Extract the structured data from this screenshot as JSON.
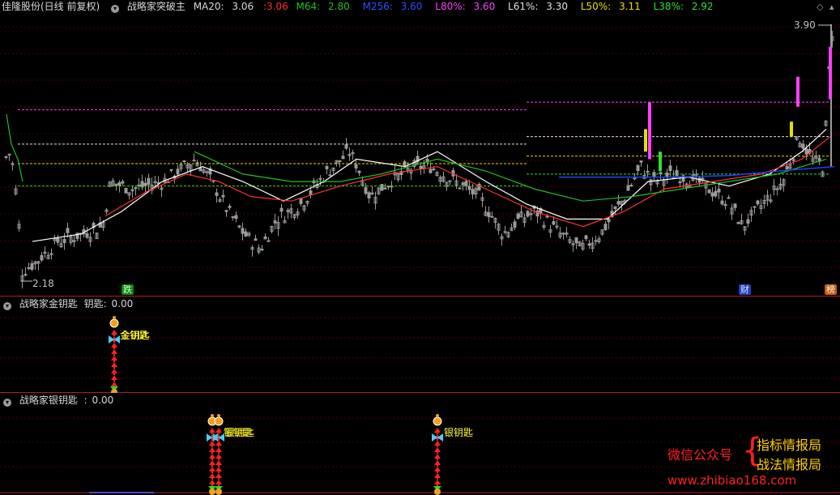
{
  "main_panel": {
    "title": "佳隆股份(日线 前复权)",
    "indicator_name": "战略家突破主",
    "ma20": {
      "label": "MA20:",
      "value": "3.06"
    },
    "extra_value": ":3.06",
    "m64": {
      "label": "M64:",
      "value": "2.80"
    },
    "m256": {
      "label": "M256:",
      "value": "3.60"
    },
    "l80": {
      "label": "L80%:",
      "value": "3.60"
    },
    "l61": {
      "label": "L61%:",
      "value": "3.30"
    },
    "l50": {
      "label": "L50%:",
      "value": "3.11"
    },
    "l38": {
      "label": "L38%:",
      "value": "2.92"
    },
    "high_label": "3.90",
    "low_label": "2.18",
    "markers": {
      "die": "跌",
      "cai": "财",
      "bang": "榜"
    }
  },
  "panel_gold": {
    "title": "战略家金钥匙",
    "series_label": "钥匙:",
    "series_value": "0.00",
    "signal_text": "金钥匙"
  },
  "panel_silver": {
    "title": "战略家银钥匙",
    "series_label": ":",
    "series_value": "0.00",
    "signal_text_a": "银钥匙",
    "signal_text_b": "银钥匙"
  },
  "watermark": {
    "wechat": "微信公众号",
    "line1": "指标情报局",
    "line2": "战法情报局",
    "url": "www.zhibiao168.com"
  },
  "colors": {
    "candle": "#9a9a9a",
    "ma_white": "#ffffff",
    "ma_red": "#ff3030",
    "ma_green": "#20c020",
    "ma_blue": "#2040ff",
    "level_magenta": "#ff40ff",
    "level_white": "#e0e0e0",
    "level_yellow": "#e0e000",
    "level_green": "#30e030",
    "separator": "#b02020"
  }
}
